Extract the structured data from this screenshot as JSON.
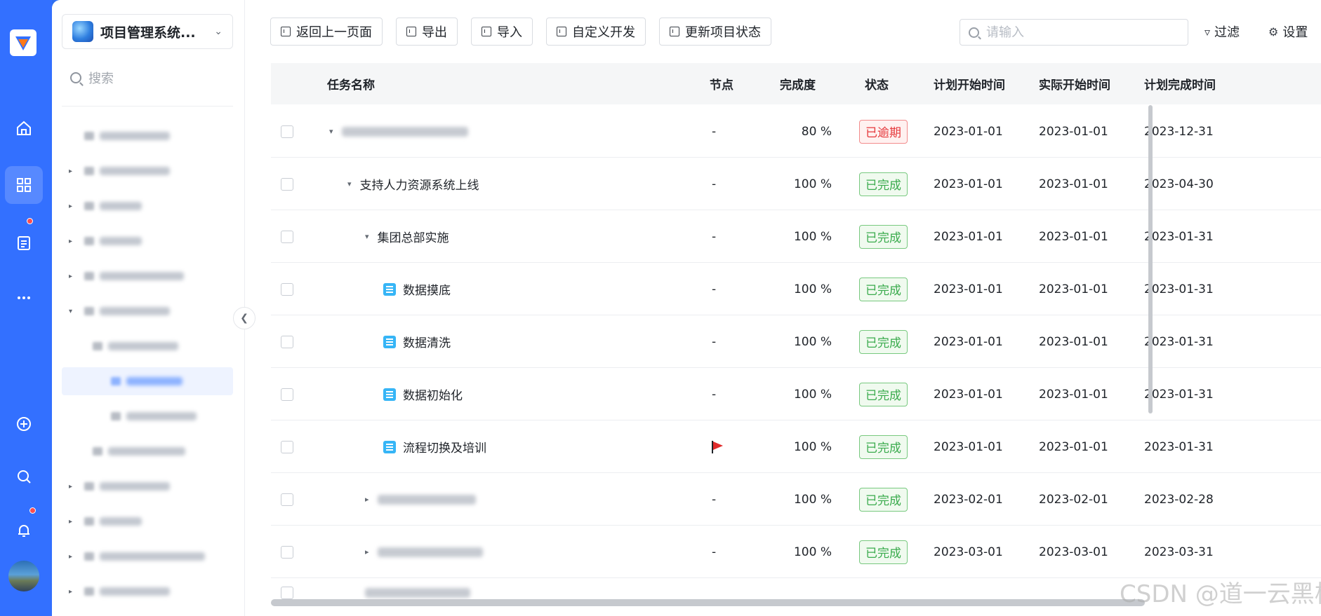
{
  "sidebar_rail": {
    "nav_icons": [
      "home-icon",
      "apps-icon",
      "doc-icon",
      "more-icon",
      "add-icon",
      "search-icon",
      "bell-icon"
    ]
  },
  "project": {
    "name": "项目管理系统...",
    "search_placeholder": "搜索"
  },
  "toolbar": {
    "back_label": "返回上一页面",
    "export_label": "导出",
    "import_label": "导入",
    "custom_dev_label": "自定义开发",
    "update_status_label": "更新项目状态",
    "search_placeholder": "请输入",
    "filter_label": "过滤",
    "settings_label": "设置"
  },
  "table": {
    "headers": {
      "name": "任务名称",
      "node": "节点",
      "progress": "完成度",
      "status": "状态",
      "plan_start": "计划开始时间",
      "actual_start": "实际开始时间",
      "plan_end": "计划完成时间"
    },
    "rows": [
      {
        "name": "",
        "node": "-",
        "progress": "80 %",
        "status": "已逾期",
        "plan_start": "2023-01-01",
        "actual_start": "2023-01-01",
        "plan_end": "2023-12-31"
      },
      {
        "name": "支持人力资源系统上线",
        "node": "-",
        "progress": "100 %",
        "status": "已完成",
        "plan_start": "2023-01-01",
        "actual_start": "2023-01-01",
        "plan_end": "2023-04-30"
      },
      {
        "name": "集团总部实施",
        "node": "-",
        "progress": "100 %",
        "status": "已完成",
        "plan_start": "2023-01-01",
        "actual_start": "2023-01-01",
        "plan_end": "2023-01-31"
      },
      {
        "name": "数据摸底",
        "node": "-",
        "progress": "100 %",
        "status": "已完成",
        "plan_start": "2023-01-01",
        "actual_start": "2023-01-01",
        "plan_end": "2023-01-31"
      },
      {
        "name": "数据清洗",
        "node": "-",
        "progress": "100 %",
        "status": "已完成",
        "plan_start": "2023-01-01",
        "actual_start": "2023-01-01",
        "plan_end": "2023-01-31"
      },
      {
        "name": "数据初始化",
        "node": "-",
        "progress": "100 %",
        "status": "已完成",
        "plan_start": "2023-01-01",
        "actual_start": "2023-01-01",
        "plan_end": "2023-01-31"
      },
      {
        "name": "流程切换及培训",
        "node": "",
        "progress": "100 %",
        "status": "已完成",
        "plan_start": "2023-01-01",
        "actual_start": "2023-01-01",
        "plan_end": "2023-01-31"
      },
      {
        "name": "",
        "node": "-",
        "progress": "100 %",
        "status": "已完成",
        "plan_start": "2023-02-01",
        "actual_start": "2023-02-01",
        "plan_end": "2023-02-28"
      },
      {
        "name": "",
        "node": "-",
        "progress": "100 %",
        "status": "已完成",
        "plan_start": "2023-03-01",
        "actual_start": "2023-03-01",
        "plan_end": "2023-03-31"
      }
    ]
  },
  "watermark": "CSDN @道一云黑板报",
  "colors": {
    "rail": "#3370ff",
    "done": "#3aab4d",
    "late": "#e5383b",
    "task_icon": "#36b5f6"
  }
}
